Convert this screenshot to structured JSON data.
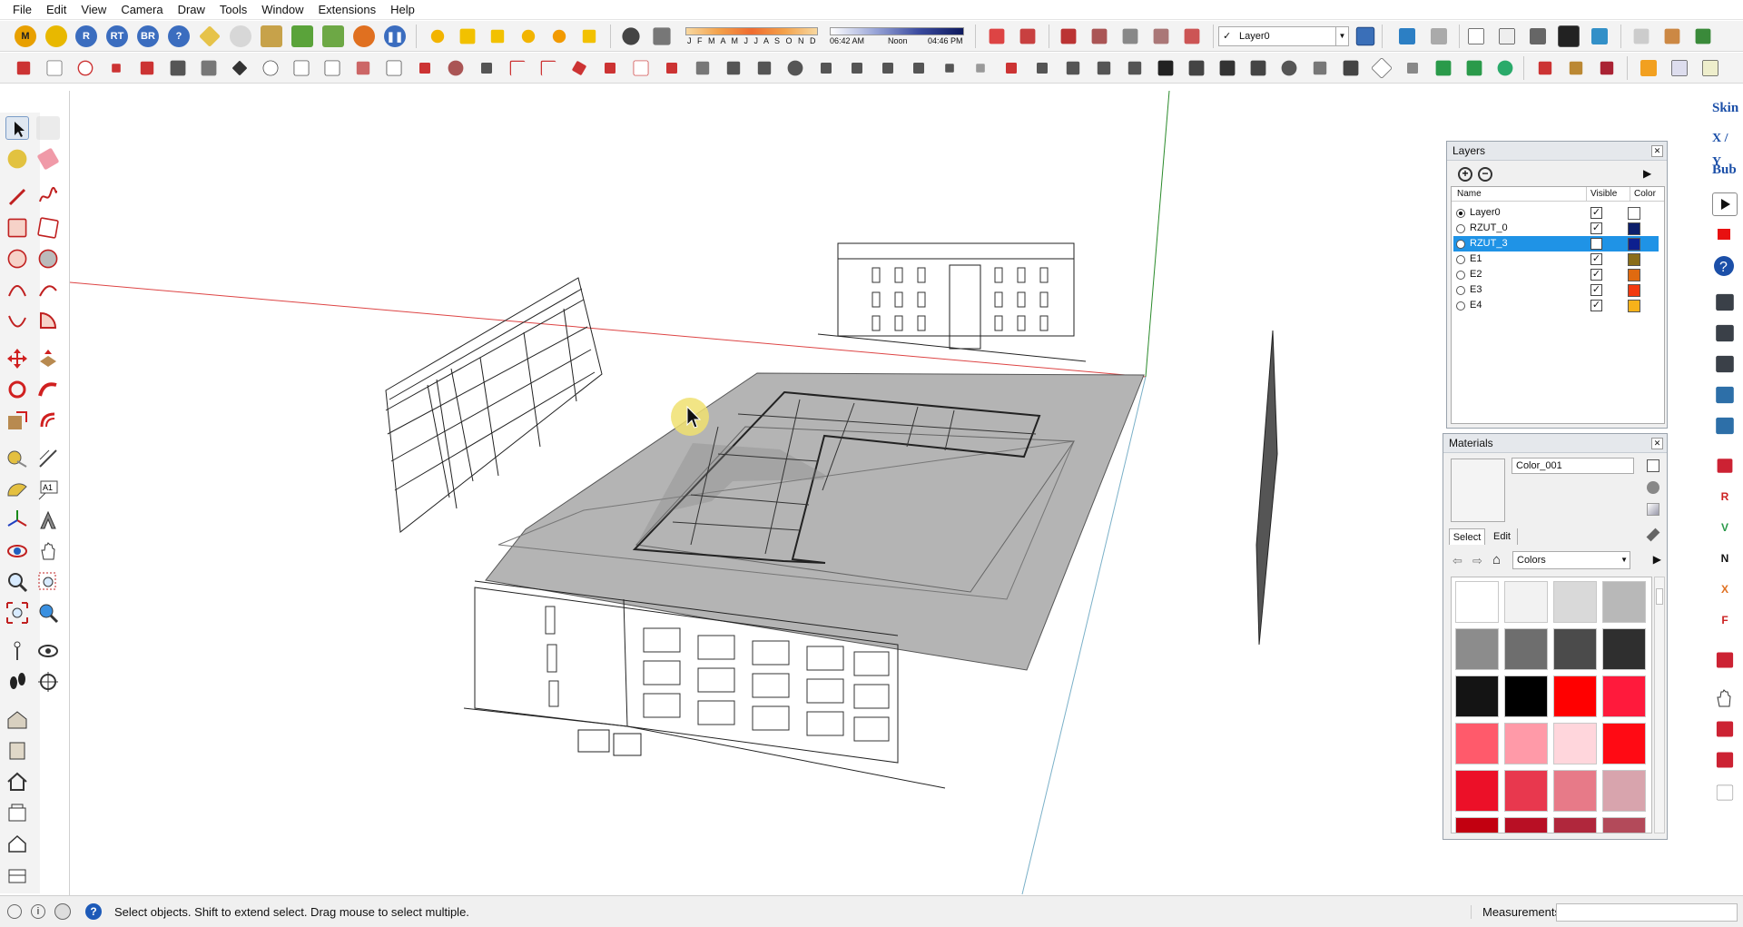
{
  "menu": [
    "File",
    "Edit",
    "View",
    "Camera",
    "Draw",
    "Tools",
    "Window",
    "Extensions",
    "Help"
  ],
  "shadow": {
    "months": "J F M A M J J A S O N D",
    "time_start": "06:42 AM",
    "time_mid": "Noon",
    "time_end": "04:46 PM"
  },
  "layer_dropdown": {
    "check": "✓",
    "value": "Layer0"
  },
  "layers_panel": {
    "title": "Layers",
    "col_name": "Name",
    "col_visible": "Visible",
    "col_color": "Color",
    "rows": [
      {
        "name": "Layer0",
        "visible": true,
        "active": true,
        "color": "#ffffff"
      },
      {
        "name": "RZUT_0",
        "visible": true,
        "active": false,
        "color": "#0d1f6b"
      },
      {
        "name": "RZUT_3",
        "visible": false,
        "active": false,
        "selected": true,
        "color": "#0d1f8f"
      },
      {
        "name": "E1",
        "visible": true,
        "active": false,
        "color": "#8a6d18"
      },
      {
        "name": "E2",
        "visible": true,
        "active": false,
        "color": "#e06a10"
      },
      {
        "name": "E3",
        "visible": true,
        "active": false,
        "color": "#f23a10"
      },
      {
        "name": "E4",
        "visible": true,
        "active": false,
        "color": "#f7b21a"
      }
    ]
  },
  "materials_panel": {
    "title": "Materials",
    "name": "Color_001",
    "tab_select": "Select",
    "tab_edit": "Edit",
    "library": "Colors",
    "swatches": [
      "#ffffff",
      "#f2f2f2",
      "#d9d9d9",
      "#b8b8b8",
      "#8c8c8c",
      "#6e6e6e",
      "#4b4b4b",
      "#2f2f2f",
      "#141414",
      "#000000",
      "#ff0000",
      "#ff1a3c",
      "#ff5a6b",
      "#ff9aa8",
      "#ffd6dc",
      "#ff0a14",
      "#ec1028",
      "#e8384e",
      "#e77a88",
      "#d8a4ad",
      "#c20010",
      "#b80f24",
      "#b0273c",
      "#b34a5a"
    ]
  },
  "right_toolbar": {
    "skin": "Skin",
    "xy": "X / Y",
    "bub": "Bub"
  },
  "status": {
    "text": "Select objects. Shift to extend select. Drag mouse to select multiple.",
    "measurements_label": "Measurements"
  }
}
